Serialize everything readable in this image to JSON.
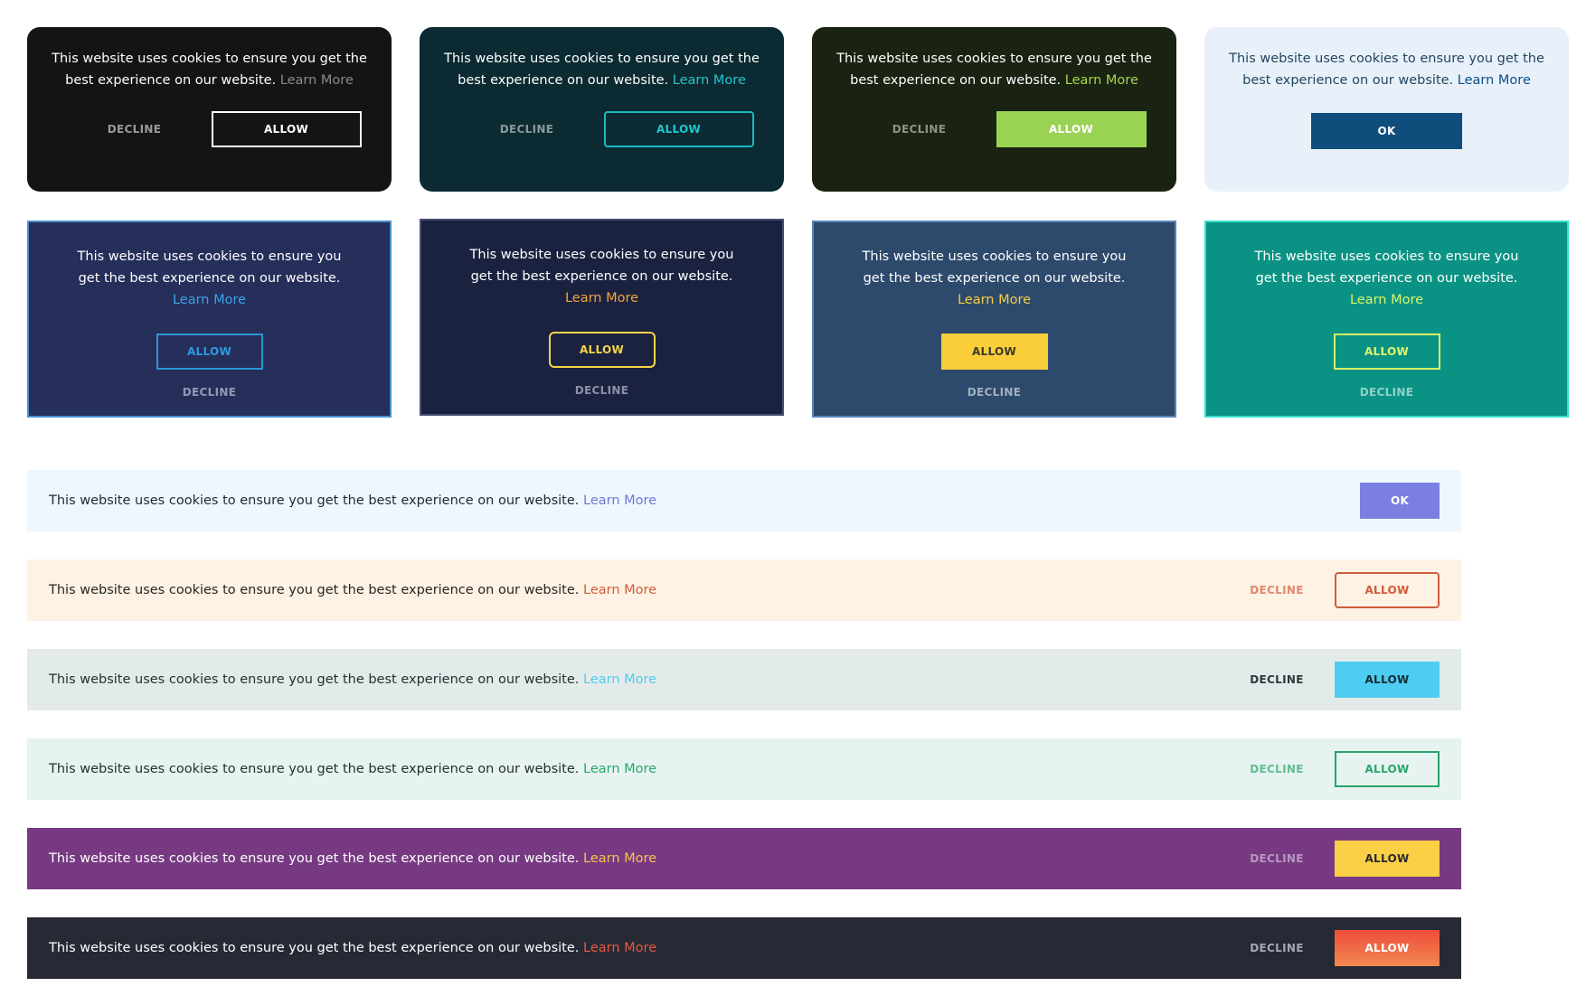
{
  "message": "This website uses cookies to ensure you get the best experience on our website.",
  "link_text": "Learn More",
  "labels": {
    "decline": "DECLINE",
    "allow": "ALLOW",
    "ok": "OK"
  },
  "colors": {
    "card_1_bg": "#141414",
    "card_2_bg": "#0b2a31",
    "card_3_bg": "#1a2211",
    "card_4_bg": "#e8f1fa",
    "card_5_bg": "#262e5a",
    "card_6_bg": "#1b2240",
    "card_7_bg": "#2d4a6c",
    "card_8_bg": "#0a9384",
    "bar_1_bg": "#eef7fd",
    "bar_2_bg": "#fdf2e3",
    "bar_3_bg": "#e3ebea",
    "bar_4_bg": "#e6f3f0",
    "bar_5_bg": "#773a82",
    "bar_6_bg": "#262a35"
  }
}
